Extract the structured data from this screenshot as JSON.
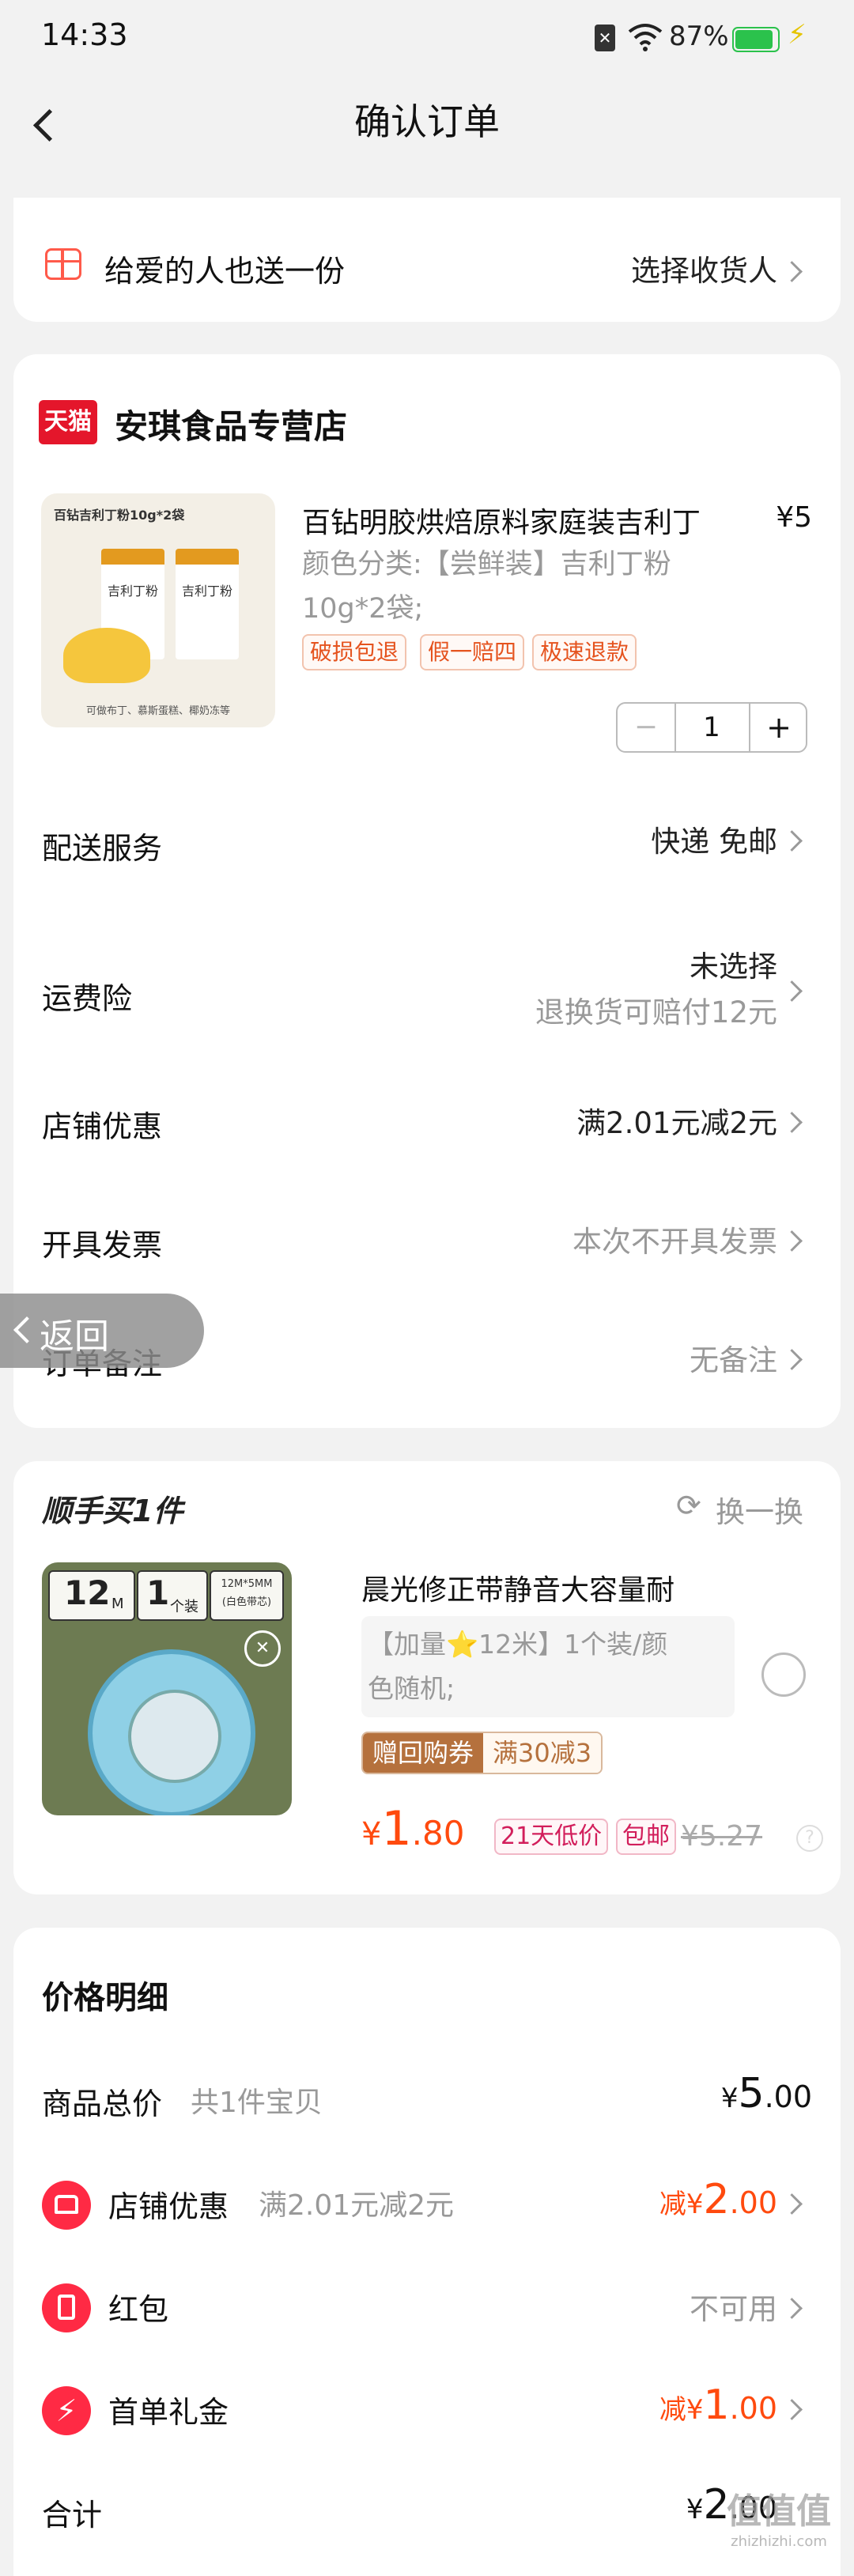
{
  "status_bar": {
    "time": "14:33",
    "battery": "87%"
  },
  "header": {
    "title": "确认订单"
  },
  "gift": {
    "label": "给爱的人也送一份",
    "action": "选择收货人"
  },
  "store": {
    "badge": "天猫",
    "name": "安琪食品专营店",
    "product": {
      "image_caption": "百钻吉利丁粉10g*2袋",
      "image_pack_label": "吉利丁粉",
      "image_bottom_text": "可做布丁、慕斯蛋糕、椰奶冻等",
      "title": "百钻明胶烘焙原料家庭装吉利丁",
      "price": "¥5",
      "spec_line1": "颜色分类:【尝鲜装】吉利丁粉",
      "spec_line2": "10g*2袋;",
      "tags": [
        "破损包退",
        "假一赔四",
        "极速退款"
      ],
      "quantity": "1",
      "minus": "−",
      "plus": "+"
    },
    "rows": {
      "delivery": {
        "label": "配送服务",
        "value": "快递 免邮"
      },
      "insurance": {
        "label": "运费险",
        "value": "未选择",
        "sub": "退换货可赔付12元"
      },
      "discount": {
        "label": "店铺优惠",
        "value": "满2.01元减2元"
      },
      "invoice": {
        "label": "开具发票",
        "value": "本次不开具发票"
      },
      "note": {
        "label": "订单备注",
        "value": "无备注"
      }
    }
  },
  "back_float": {
    "label": "返回"
  },
  "addon": {
    "title": "顺手买1件",
    "refresh": "换一换",
    "product": {
      "img_num1": "12",
      "img_unit1": "M",
      "img_num2": "1",
      "img_unit2": "个装",
      "img_spec1": "12M*5MM",
      "img_spec2": "(白色带芯)",
      "title": "晨光修正带静音大容量耐",
      "spec_line1": "【加量⭐12米】1个装/颜",
      "spec_line2": "色随机;",
      "coupon_label": "赠回购券",
      "coupon_value": "满30减3",
      "price_symbol": "¥",
      "price_int": "1",
      "price_dec": ".80",
      "badge_low": "21天低价",
      "badge_ship": "包邮",
      "orig_price": "¥5.27"
    }
  },
  "price_detail": {
    "title": "价格明细",
    "total_goods": {
      "label": "商品总价",
      "sub": "共1件宝贝",
      "symbol": "¥",
      "int": "5",
      "dec": ".00"
    },
    "shop_discount": {
      "label": "店铺优惠",
      "sub": "满2.01元减2元",
      "prefix": "减",
      "symbol": "¥",
      "int": "2",
      "dec": ".00"
    },
    "red_packet": {
      "label": "红包",
      "value": "不可用"
    },
    "first_gift": {
      "label": "首单礼金",
      "prefix": "减",
      "symbol": "¥",
      "int": "1",
      "dec": ".00"
    },
    "total": {
      "label": "合计",
      "symbol": "¥",
      "int": "2",
      "dec": ".00"
    }
  },
  "watermark": {
    "text": "值值值",
    "sub": "zhizhizhi.com"
  },
  "colors": {
    "accent": "#ff4a0e",
    "tmall_red": "#e4162b",
    "coupon_brown": "#b5713d"
  }
}
